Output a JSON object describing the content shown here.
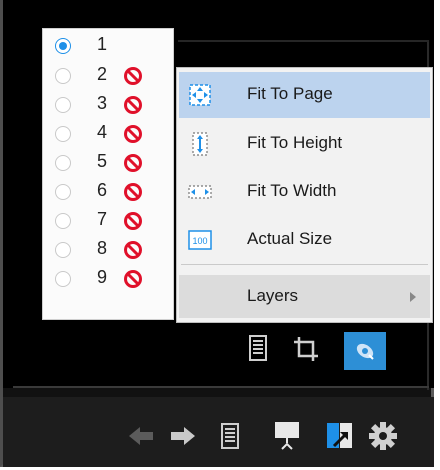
{
  "layers": {
    "items": [
      {
        "label": "1",
        "checked": true,
        "disabled": false
      },
      {
        "label": "2",
        "checked": false,
        "disabled": true
      },
      {
        "label": "3",
        "checked": false,
        "disabled": true
      },
      {
        "label": "4",
        "checked": false,
        "disabled": true
      },
      {
        "label": "5",
        "checked": false,
        "disabled": true
      },
      {
        "label": "6",
        "checked": false,
        "disabled": true
      },
      {
        "label": "7",
        "checked": false,
        "disabled": true
      },
      {
        "label": "8",
        "checked": false,
        "disabled": true
      },
      {
        "label": "9",
        "checked": false,
        "disabled": true
      }
    ]
  },
  "context_menu": {
    "items": [
      {
        "label": "Fit To Page",
        "icon": "fit-to-page-icon",
        "highlighted": true
      },
      {
        "label": "Fit To Height",
        "icon": "fit-to-height-icon",
        "highlighted": false
      },
      {
        "label": "Fit To Width",
        "icon": "fit-to-width-icon",
        "highlighted": false
      },
      {
        "label": "Actual Size",
        "icon": "actual-size-icon",
        "icon_text": "100",
        "highlighted": false
      }
    ],
    "submenu": {
      "label": "Layers"
    }
  },
  "colors": {
    "accent": "#2d8fd6",
    "highlight": "#bcd3ee",
    "disabled_red": "#e0102a",
    "icon_blue": "#1e90e8"
  }
}
